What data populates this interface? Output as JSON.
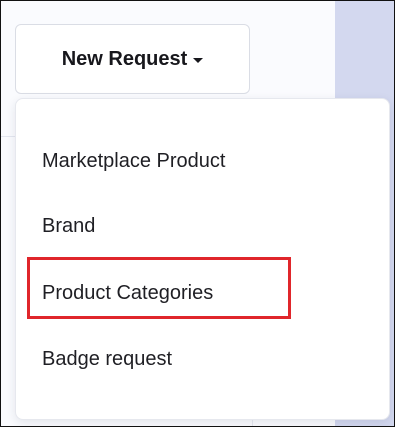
{
  "new_request": {
    "label": "New Request"
  },
  "dropdown": {
    "items": [
      {
        "label": "Marketplace Product"
      },
      {
        "label": "Brand"
      },
      {
        "label": "Product Categories"
      },
      {
        "label": "Badge request"
      }
    ],
    "highlighted_item": "Product Categories"
  },
  "colors": {
    "highlight_border": "#e0262b",
    "right_panel": "#d3d8ef"
  },
  "icons": {
    "caret": "caret-down-icon"
  }
}
